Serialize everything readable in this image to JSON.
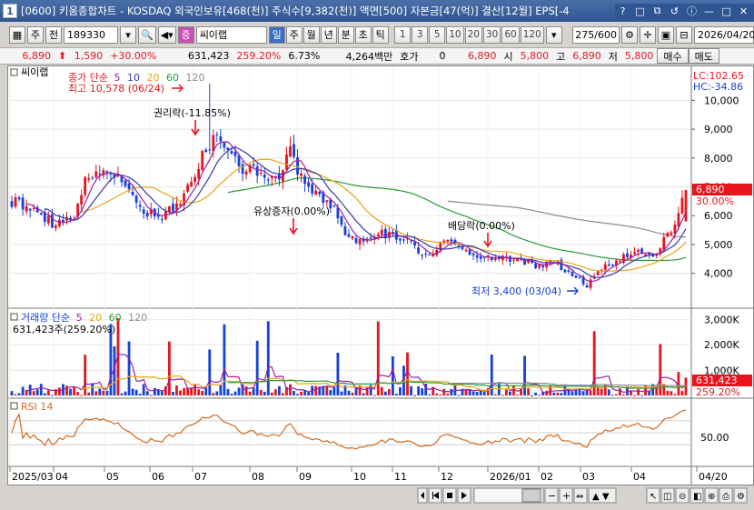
{
  "window": {
    "number": "1",
    "title": "[0600] 키움종합차트 - KOSDAQ 외국인보유[468(천)] 주식수[9,382(천)] 액면[500] 자본금[47(억)] 결산[12월] EPS[-4",
    "buttons": [
      "?",
      "□",
      "⧉",
      "↺",
      "ⓘ",
      "—",
      "□",
      "✕"
    ]
  },
  "toolbar": {
    "grid_label": "주",
    "prev_label": "전",
    "code": "189330",
    "market_badge": "증",
    "stock_name": "씨이랩",
    "periods": [
      "일",
      "주",
      "월",
      "년",
      "분",
      "초",
      "틱"
    ],
    "selected_period": "일",
    "intervals": [
      "1",
      "3",
      "5",
      "10",
      "20",
      "30",
      "60",
      "120"
    ],
    "count": "275",
    "count_total": "/600",
    "date": "2026/04/20"
  },
  "quote": {
    "price": "6,890",
    "change": "1,590",
    "change_pct": "+30.00%",
    "volume": "631,423",
    "volume_pct": "259.20%",
    "turnover": "6.73%",
    "amount": "4,264백만",
    "hoga_label": "호가",
    "hoga_value": "0",
    "ask": "6,890",
    "open_label": "시",
    "open": "5,800",
    "high_label": "고",
    "high": "6,890",
    "low_label": "저",
    "low": "5,800",
    "buy_label": "매수",
    "sell_label": "매도"
  },
  "price_panel": {
    "stock_label": "씨이랩",
    "legend_prefix": "종가 단순",
    "ma_periods": [
      "5",
      "10",
      "20",
      "60",
      "120"
    ],
    "high_note": "최고 10,578 (06/24)",
    "low_note": "최저 3,400 (03/04)",
    "events": [
      "권리락(-11.85%)",
      "유상증자(0.00%)",
      "배당락(0.00%)"
    ],
    "lc": "LC:102.65",
    "hc": "HC:-34.86",
    "y_ticks": [
      "10,000",
      "9,000",
      "8,000",
      "7,000",
      "6,000",
      "5,000",
      "4,000"
    ],
    "current_price": "6,890",
    "current_pct": "30.00%"
  },
  "volume_panel": {
    "legend_prefix": "거래량 단순",
    "ma_periods": [
      "5",
      "20",
      "60",
      "120"
    ],
    "value_note": "631,423주(259.20%)",
    "y_ticks": [
      "3,000K",
      "2,000K",
      "1,000K"
    ],
    "current": "631,423",
    "current_pct": "259.20%"
  },
  "rsi_panel": {
    "label": "RSI 14",
    "y_tick": "50.00"
  },
  "x_axis": {
    "labels": [
      "2025/03",
      "04",
      "05",
      "06",
      "07",
      "08",
      "09",
      "10",
      "11",
      "12",
      "2026/01",
      "02",
      "03",
      "04",
      "04/20"
    ]
  },
  "colors": {
    "up": "#e8141e",
    "down": "#1542d8",
    "ma5": "#9b1fa3",
    "ma10": "#3a3aa8",
    "ma20": "#e8a317",
    "ma60": "#2a9a3a",
    "ma120": "#8a8a8a",
    "rsi": "#d2691e",
    "title": "#2f5592"
  }
}
